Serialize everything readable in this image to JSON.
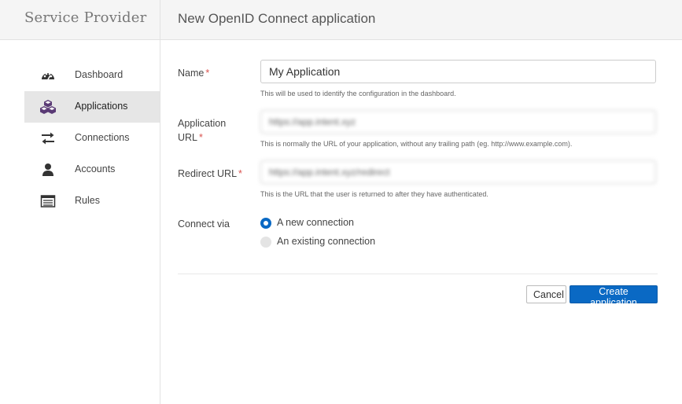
{
  "app": {
    "brand": "Service Provider",
    "page_title": "New OpenID Connect application"
  },
  "sidebar": {
    "items": [
      {
        "label": "Dashboard",
        "icon": "dashboard-icon",
        "active": false
      },
      {
        "label": "Applications",
        "icon": "applications-icon",
        "active": true
      },
      {
        "label": "Connections",
        "icon": "connections-icon",
        "active": false
      },
      {
        "label": "Accounts",
        "icon": "accounts-icon",
        "active": false
      },
      {
        "label": "Rules",
        "icon": "rules-icon",
        "active": false
      }
    ]
  },
  "form": {
    "name": {
      "label": "Name",
      "required": "*",
      "value": "My Application",
      "hint": "This will be used to identify the configuration in the dashboard."
    },
    "app_url": {
      "label_line1": "Application",
      "label_line2": "URL",
      "required": "*",
      "value": "https://app.intent.xyz",
      "hint": "This is normally the URL of your application, without any trailing path (eg. http://www.example.com)."
    },
    "redirect_url": {
      "label": "Redirect URL",
      "required": "*",
      "value": "https://app.intent.xyz/redirect",
      "hint": "This is the URL that the user is returned to after they have authenticated."
    },
    "connect_via": {
      "label": "Connect via",
      "options": [
        {
          "label": "A new connection",
          "selected": true
        },
        {
          "label": "An existing connection",
          "selected": false
        }
      ]
    }
  },
  "actions": {
    "cancel_label": "Cancel",
    "create_label": "Create application"
  },
  "colors": {
    "primary": "#0a69c4",
    "required": "#d9534f",
    "active_nav_bg": "#e6e6e6"
  }
}
